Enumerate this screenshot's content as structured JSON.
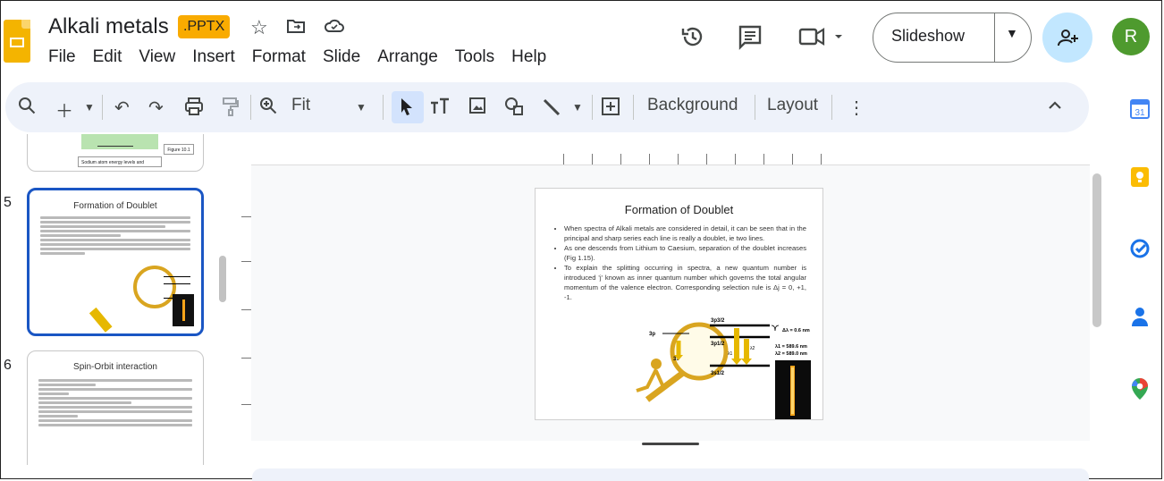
{
  "app": {
    "title": "Alkali metals",
    "file_type_badge": ".PPTX",
    "menu": [
      "File",
      "Edit",
      "View",
      "Insert",
      "Format",
      "Slide",
      "Arrange",
      "Tools",
      "Help"
    ],
    "slideshow_label": "Slideshow",
    "avatar_initial": "R"
  },
  "toolbar": {
    "zoom_label": "Fit",
    "background_label": "Background",
    "layout_label": "Layout"
  },
  "filmstrip": {
    "prev_slide_caption": "Sodium atom energy levels and transitions",
    "prev_slide_figure": "Figure 10.1",
    "slides": [
      {
        "number": "5",
        "title": "Formation of Doublet"
      },
      {
        "number": "6",
        "title": "Spin-Orbit interaction"
      }
    ]
  },
  "slide": {
    "title": "Formation of Doublet",
    "bullets": [
      "When spectra of Alkali metals are considered in detail, it can be seen that in the principal and sharp series each line is really a doublet, ie two lines.",
      "As one descends from Lithium to Caesium, separation of the doublet increases (Fig 1.15).",
      "To explain the splitting occurring in spectra, a new quantum number is introduced 'j' known as inner quantum number which governs the total angular momentum of the valence electron. Corresponding selection rule is Δj = 0, +1, -1."
    ],
    "diagram": {
      "label_3p": "3p",
      "label_3p32": "3p3/2",
      "label_3p12": "3p1/2",
      "label_3s": "3s",
      "label_3s12": "3s1/2",
      "delta_lambda": "Δλ = 0.6 nm",
      "lambda1": "λ1 = 589.6 nm",
      "lambda2": "λ2 = 589.0 nm",
      "l1": "λ1",
      "l2": "λ2"
    }
  },
  "colors": {
    "accent": "#1a56c4",
    "toolbar_bg": "#eef2fa",
    "badge": "#f9ab00",
    "share_bg": "#c2e7ff",
    "avatar_bg": "#4e9a2e"
  }
}
